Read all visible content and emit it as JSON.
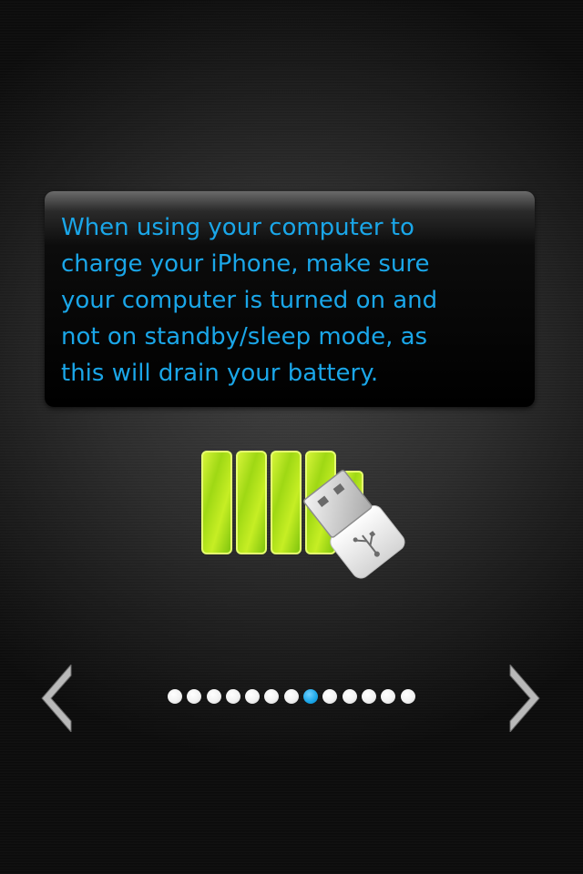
{
  "tip": {
    "text": "When using your computer to\ncharge your iPhone, make sure\nyour computer is turned on and\nnot on standby/sleep mode, as\nthis will drain your battery."
  },
  "illustration": {
    "icons": [
      "battery-icon",
      "usb-plug-icon"
    ],
    "battery_color": "#b8e81a"
  },
  "navigation": {
    "prev_icon": "chevron-left-icon",
    "next_icon": "chevron-right-icon"
  },
  "pager": {
    "total_pages": 13,
    "current_page": 8
  },
  "colors": {
    "accent": "#1aa6e8",
    "background": "#2c2c2c",
    "dot_inactive": "#f2f2f2"
  }
}
